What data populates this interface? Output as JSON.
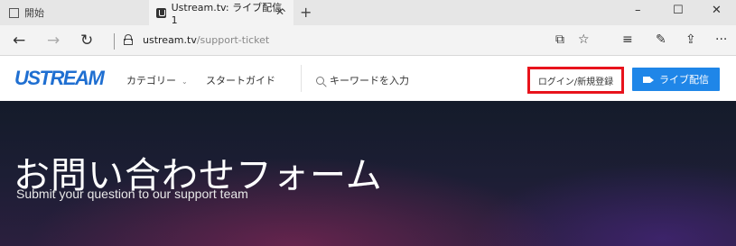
{
  "browser": {
    "tabs": [
      {
        "label": "開始",
        "icon": "page-icon"
      },
      {
        "label": "Ustream.tv: ライブ配信、1",
        "icon": "ustream-favicon-icon",
        "close": "✕"
      }
    ],
    "new_tab": "+",
    "window_controls": {
      "minimize": "–",
      "maximize": "☐",
      "close": "✕"
    },
    "nav": {
      "back": "←",
      "forward": "→",
      "refresh": "↻"
    },
    "url_host": "ustream.tv",
    "url_path": "/support-ticket",
    "tools": {
      "reading_view": "⧉",
      "favorite": "☆",
      "hub": "≡",
      "notes": "✎",
      "share": "⇪",
      "more": "···"
    }
  },
  "site": {
    "logo": "USTREAM",
    "nav": {
      "category": "カテゴリー",
      "category_chevron": "⌄",
      "start_guide": "スタートガイド"
    },
    "search_placeholder": "キーワードを入力",
    "login_label": "ログイン/新規登録",
    "live_label": "ライブ配信"
  },
  "hero": {
    "title": "お問い合わせフォーム",
    "subtitle": "Submit your question to our support team"
  },
  "colors": {
    "brand": "#1f6fd1",
    "live_button": "#1f86e8",
    "highlight_box": "#e8131c"
  }
}
